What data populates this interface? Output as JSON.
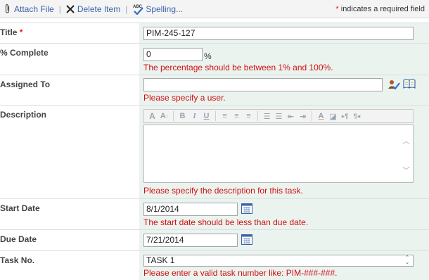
{
  "toolbar": {
    "attach_label": "Attach File",
    "delete_label": "Delete Item",
    "spelling_label": "Spelling...",
    "required_star": "*",
    "required_note": "indicates a required field"
  },
  "fields": {
    "title": {
      "label": "Title",
      "required_mark": "*",
      "value": "PIM-245-127"
    },
    "percent": {
      "label": "% Complete",
      "value": "0",
      "unit": "%",
      "error": "The percentage should be between 1% and 100%."
    },
    "assigned": {
      "label": "Assigned To",
      "value": "",
      "error": "Please specify a user."
    },
    "description": {
      "label": "Description",
      "value": "",
      "error": "Please specify the description for this task."
    },
    "start_date": {
      "label": "Start Date",
      "value": "8/1/2014",
      "error": "The start date should be less than due date."
    },
    "due_date": {
      "label": "Due Date",
      "value": "7/21/2014"
    },
    "task_no": {
      "label": "Task No.",
      "value": "TASK 1",
      "error": "Please enter a valid task number like: PIM-###-###."
    }
  },
  "colors": {
    "link": "#3b63a8",
    "error": "#d01010",
    "field_bg": "#ebf3ef",
    "required": "#e21111"
  },
  "icons": [
    "paperclip-icon",
    "delete-x-icon",
    "spellcheck-icon",
    "check-names-icon",
    "address-book-icon",
    "calendar-icon"
  ]
}
